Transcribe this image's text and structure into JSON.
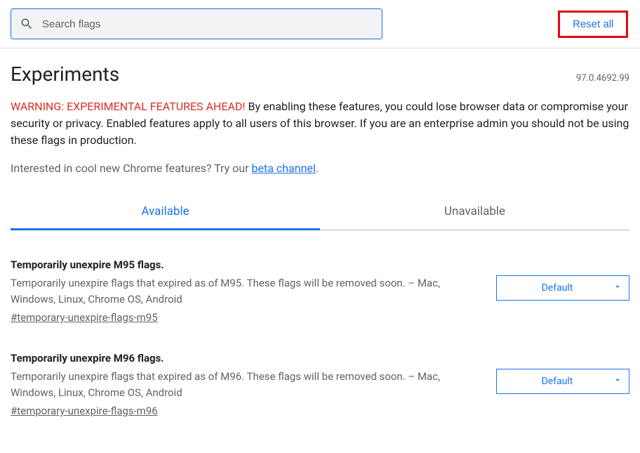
{
  "search": {
    "placeholder": "Search flags"
  },
  "reset_button_label": "Reset all",
  "page_title": "Experiments",
  "version": "97.0.4692.99",
  "warning": {
    "prefix": "WARNING: EXPERIMENTAL FEATURES AHEAD!",
    "body": " By enabling these features, you could lose browser data or compromise your security or privacy. Enabled features apply to all users of this browser. If you are an enterprise admin you should not be using these flags in production."
  },
  "promo": {
    "text_before": "Interested in cool new Chrome features? Try our ",
    "link_text": "beta channel",
    "text_after": "."
  },
  "tabs": {
    "available": "Available",
    "unavailable": "Unavailable"
  },
  "flags": [
    {
      "title": "Temporarily unexpire M95 flags.",
      "description": "Temporarily unexpire flags that expired as of M95. These flags will be removed soon. – Mac, Windows, Linux, Chrome OS, Android",
      "anchor": "#temporary-unexpire-flags-m95",
      "selected": "Default"
    },
    {
      "title": "Temporarily unexpire M96 flags.",
      "description": "Temporarily unexpire flags that expired as of M96. These flags will be removed soon. – Mac, Windows, Linux, Chrome OS, Android",
      "anchor": "#temporary-unexpire-flags-m96",
      "selected": "Default"
    }
  ]
}
